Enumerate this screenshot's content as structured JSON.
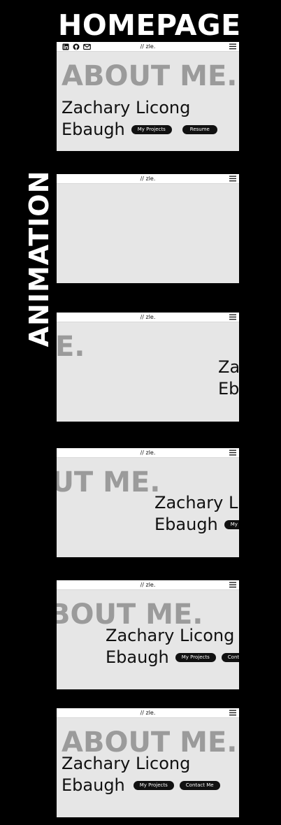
{
  "heading": "HOMEPAGE",
  "side_label": "ANIMATION",
  "site": {
    "brand": "// zle.",
    "about": "ABOUT ME.",
    "name_line1": "Zachary Licong",
    "name_line2": "Ebaugh",
    "projects_button": "My Projects",
    "resume_button": "Resume",
    "contact_button": "Contact Me"
  },
  "social_icons": [
    "linkedin-icon",
    "github-icon",
    "mail-icon"
  ],
  "frames": [
    {
      "label": "homepage",
      "about_text": "ABOUT ME.",
      "name1": "Zachary Licong",
      "name2": "Ebaugh",
      "btn1": "My Projects",
      "btn2": "Resume"
    },
    {
      "label": "animation-step-1"
    },
    {
      "label": "animation-step-2",
      "about_text": "ABOUT ME.",
      "name1": "Zachary Licong",
      "name2": "Ebaugh"
    },
    {
      "label": "animation-step-3",
      "about_text": "ABOUT ME.",
      "name1": "Zachary Licong",
      "name2": "Ebaugh",
      "btn1": "My Projects"
    },
    {
      "label": "animation-step-4",
      "about_text": "ABOUT ME.",
      "name1": "Zachary Licong",
      "name2": "Ebaugh",
      "btn1": "My Projects",
      "btn2": "Contact Me"
    },
    {
      "label": "animation-step-5",
      "about_text": "ABOUT ME.",
      "name1": "Zachary Licong",
      "name2": "Ebaugh",
      "btn1": "My Projects",
      "btn2": "Contact Me"
    }
  ]
}
